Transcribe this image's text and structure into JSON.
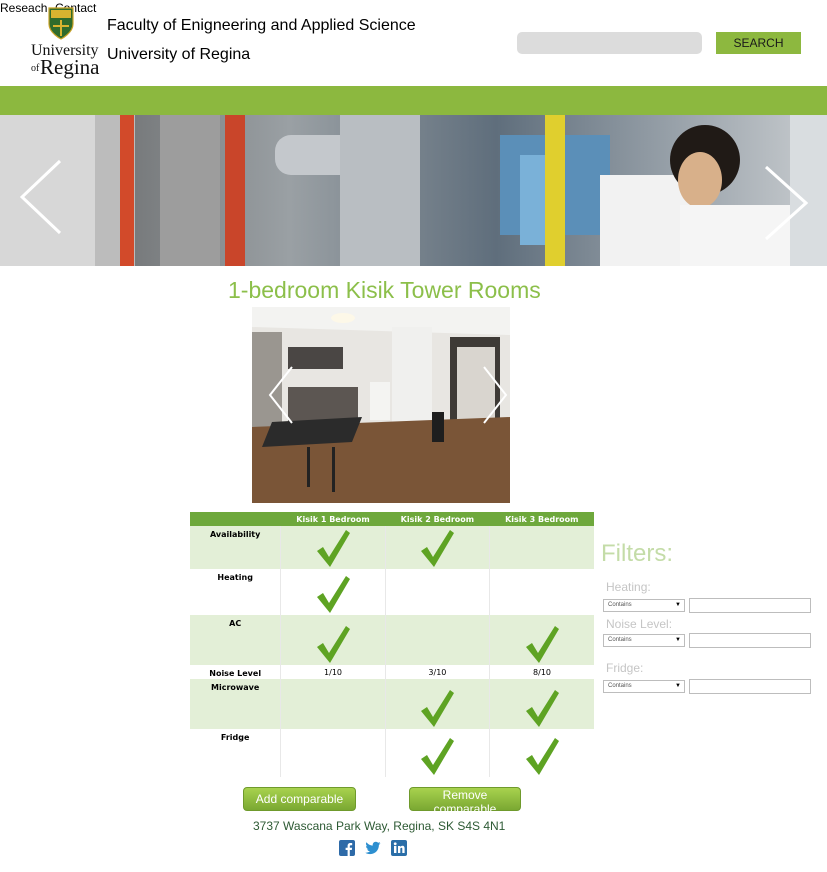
{
  "nav": {
    "research": "Reseach",
    "contact": "Contact"
  },
  "logo": {
    "line1": "University",
    "line2_small": "of",
    "line2": "Regina"
  },
  "header": {
    "faculty": "Faculty of Enigneering and Applied Science",
    "university": "University of Regina"
  },
  "search": {
    "placeholder": "",
    "button_label": "SEARCH"
  },
  "page_title": "1-bedroom Kisik Tower Rooms",
  "table": {
    "columns": [
      "Kisik 1 Bedroom",
      "Kisik 2 Bedroom",
      "Kisik 3 Bedroom"
    ],
    "rows": [
      {
        "label": "Availability",
        "cells": [
          "check",
          "check",
          ""
        ]
      },
      {
        "label": "Heating",
        "cells": [
          "check",
          "",
          ""
        ]
      },
      {
        "label": "AC",
        "cells": [
          "check",
          "",
          "check"
        ]
      },
      {
        "label": "Noise Level",
        "cells": [
          "1/10",
          "3/10",
          "8/10"
        ]
      },
      {
        "label": "Microwave",
        "cells": [
          "",
          "check",
          "check"
        ]
      },
      {
        "label": "Fridge",
        "cells": [
          "",
          "check",
          "check"
        ]
      }
    ]
  },
  "filters": {
    "title": "Filters:",
    "items": [
      {
        "label": "Heating:",
        "operator": "Contains",
        "value": ""
      },
      {
        "label": "Noise Level:",
        "operator": "Contains",
        "value": ""
      },
      {
        "label": "Fridge:",
        "operator": "Contains",
        "value": ""
      }
    ]
  },
  "buttons": {
    "add": "Add comparable",
    "remove": "Remove comparable"
  },
  "footer": {
    "address": "3737 Wascana Park Way, Regina, SK S4S 4N1"
  },
  "icons": {
    "social": [
      "facebook-icon",
      "twitter-icon",
      "linkedin-icon"
    ]
  },
  "colors": {
    "accent": "#8cb83f",
    "table_header": "#6ea83c",
    "check": "#5ea323",
    "title": "#8cbf4a"
  }
}
